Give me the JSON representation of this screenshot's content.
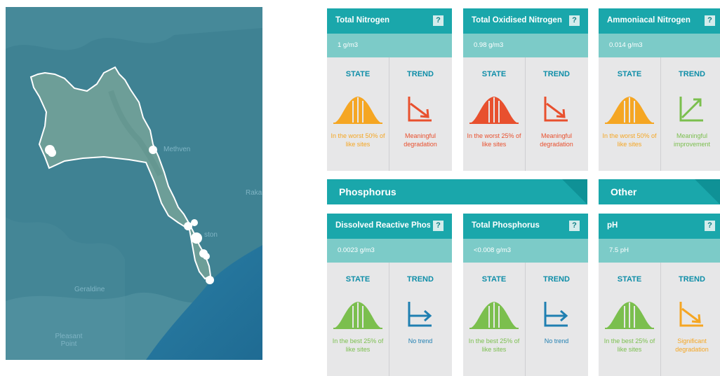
{
  "map": {
    "labels": {
      "methven": "Methven",
      "raka": "Raka",
      "town": "ston",
      "geraldine": "Geraldine",
      "pleasant": "Pleasant\nPoint"
    }
  },
  "sections": {
    "phosphorus": "Phosphorus",
    "other": "Other"
  },
  "colors": {
    "orange": "#f5a623",
    "red": "#e8502e",
    "green": "#7bbf4e",
    "blue": "#1f7fb1",
    "teal": "#1aa7ab"
  },
  "cards": [
    {
      "title": "Total Nitrogen",
      "help": "?",
      "value": "1 g/m3",
      "state_label": "STATE",
      "trend_label": "TREND",
      "state_text": "In the worst 50% of like sites",
      "state_color": "#f5a623",
      "state_icon": "bell-curve-icon",
      "trend_text": "Meaningful degradation",
      "trend_color": "#e8502e",
      "trend_icon": "trend-down-arrow-icon"
    },
    {
      "title": "Total Oxidised Nitrogen",
      "help": "?",
      "value": "0.98 g/m3",
      "state_label": "STATE",
      "trend_label": "TREND",
      "state_text": "In the worst 25% of like sites",
      "state_color": "#e8502e",
      "state_icon": "bell-curve-icon",
      "trend_text": "Meaningful degradation",
      "trend_color": "#e8502e",
      "trend_icon": "trend-down-arrow-icon"
    },
    {
      "title": "Ammoniacal Nitrogen",
      "help": "?",
      "value": "0.014 g/m3",
      "state_label": "STATE",
      "trend_label": "TREND",
      "state_text": "In the worst 50% of like sites",
      "state_color": "#f5a623",
      "state_icon": "bell-curve-icon",
      "trend_text": "Meaningful improvement",
      "trend_color": "#7bbf4e",
      "trend_icon": "trend-up-arrow-icon"
    },
    {
      "title": "Dissolved Reactive Phos...",
      "help": "?",
      "value": "0.0023 g/m3",
      "state_label": "STATE",
      "trend_label": "TREND",
      "state_text": "In the best 25% of like sites",
      "state_color": "#7bbf4e",
      "state_icon": "bell-curve-icon",
      "trend_text": "No trend",
      "trend_color": "#1f7fb1",
      "trend_icon": "trend-flat-arrow-icon"
    },
    {
      "title": "Total Phosphorus",
      "help": "?",
      "value": "<0.008 g/m3",
      "state_label": "STATE",
      "trend_label": "TREND",
      "state_text": "In the best 25% of like sites",
      "state_color": "#7bbf4e",
      "state_icon": "bell-curve-icon",
      "trend_text": "No trend",
      "trend_color": "#1f7fb1",
      "trend_icon": "trend-flat-arrow-icon"
    },
    {
      "title": "pH",
      "help": "?",
      "value": "7.5 pH",
      "state_label": "STATE",
      "trend_label": "TREND",
      "state_text": "In the best 25% of like sites",
      "state_color": "#7bbf4e",
      "state_icon": "bell-curve-icon",
      "trend_text": "Significant degradation",
      "trend_color": "#f5a623",
      "trend_icon": "trend-down-arrow-icon"
    }
  ]
}
